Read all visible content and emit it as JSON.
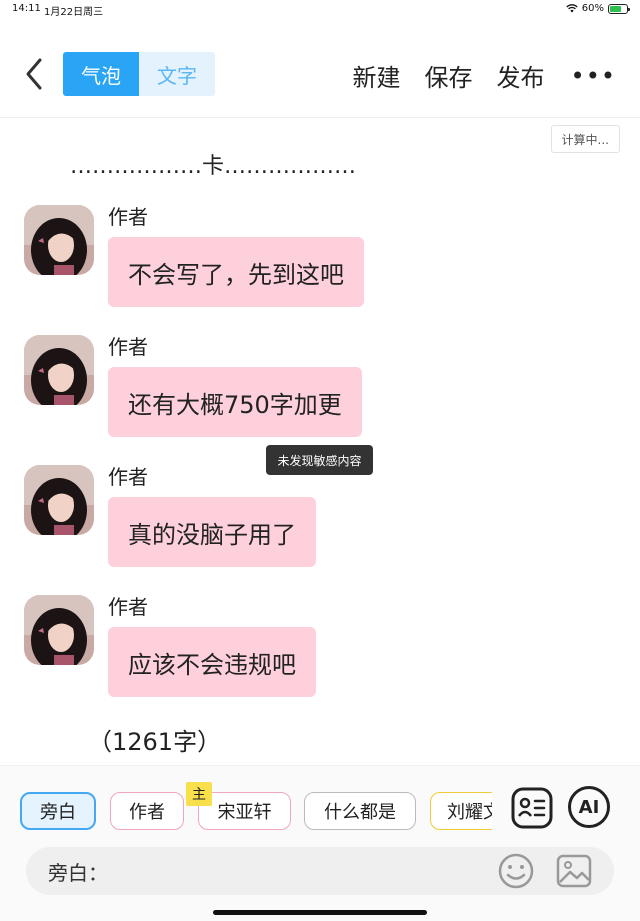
{
  "status": {
    "time": "14:11",
    "date": "1月22日周三",
    "battery": "60%",
    "battery_level": 0.6
  },
  "header": {
    "tabs": [
      {
        "label": "气泡",
        "active": true
      },
      {
        "label": "文字",
        "active": false
      }
    ],
    "actions": {
      "new": "新建",
      "save": "保存",
      "publish": "发布",
      "more": "•••"
    }
  },
  "calc_status": "计算中...",
  "narration": "………………卡………………",
  "messages": [
    {
      "author": "作者",
      "text": "不会写了，先到这吧"
    },
    {
      "author": "作者",
      "text": "还有大概750字加更"
    },
    {
      "author": "作者",
      "text": "真的没脑子用了"
    },
    {
      "author": "作者",
      "text": "应该不会违规吧"
    }
  ],
  "tooltip": "未发现敏感内容",
  "word_count": "（1261字）",
  "characters": [
    {
      "label": "旁白",
      "style": "active"
    },
    {
      "label": "作者",
      "style": "pink"
    },
    {
      "label": "宋亚轩",
      "style": "pink"
    },
    {
      "label": "什么都是",
      "style": "gray"
    },
    {
      "label": "刘耀文",
      "style": "yellow"
    }
  ],
  "main_badge": "主",
  "ai_label": "AI",
  "input": {
    "label": "旁白：",
    "placeholder": ""
  },
  "colors": {
    "accent": "#2aa4f4",
    "bubble": "#fdd0dc",
    "tooltip_bg": "#333333",
    "badge": "#f8e04d"
  }
}
